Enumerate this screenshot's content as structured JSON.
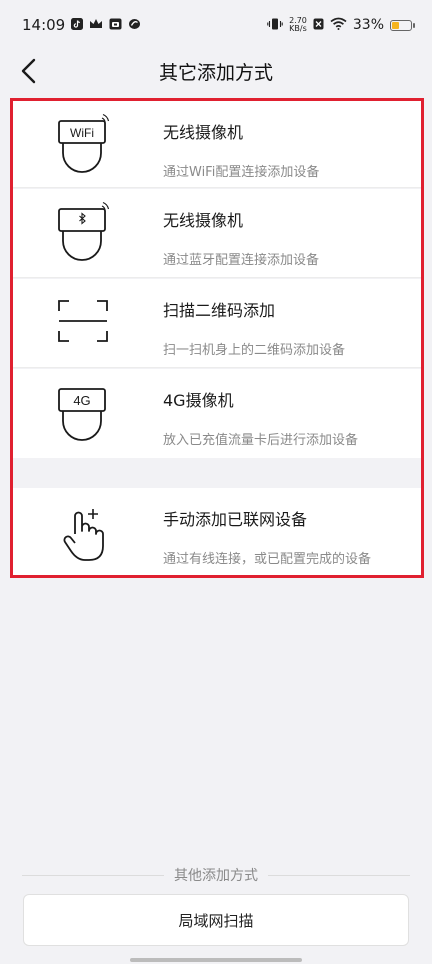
{
  "status_bar": {
    "time": "14:09",
    "net_speed_value": "2.70",
    "net_speed_unit": "KB/s",
    "battery_percent": "33%",
    "battery_level": 0.33,
    "left_icons": [
      "tiktok-icon",
      "crown-icon",
      "store-icon",
      "swirl-icon"
    ],
    "right_icons": [
      "vibrate-icon",
      "no-sim-icon",
      "wifi-icon",
      "battery-icon"
    ]
  },
  "nav": {
    "back_icon": "chevron-left-icon",
    "title": "其它添加方式"
  },
  "options": [
    {
      "icon": "wifi-camera-icon",
      "icon_text": "WiFi",
      "title": "无线摄像机",
      "subtitle": "通过WiFi配置连接添加设备"
    },
    {
      "icon": "bluetooth-camera-icon",
      "title": "无线摄像机",
      "subtitle": "通过蓝牙配置连接添加设备"
    },
    {
      "icon": "qr-scan-icon",
      "title": "扫描二维码添加",
      "subtitle": "扫一扫机身上的二维码添加设备"
    },
    {
      "icon": "4g-camera-icon",
      "icon_text": "4G",
      "title": "4G摄像机",
      "subtitle": "放入已充值流量卡后进行添加设备"
    },
    {
      "icon": "hand-tap-icon",
      "title": "手动添加已联网设备",
      "subtitle": "通过有线连接，或已配置完成的设备"
    }
  ],
  "other_methods": {
    "label": "其他添加方式",
    "lan_scan_label": "局域网扫描"
  },
  "colors": {
    "highlight_border": "#e02030",
    "battery": "#f5b41f"
  }
}
